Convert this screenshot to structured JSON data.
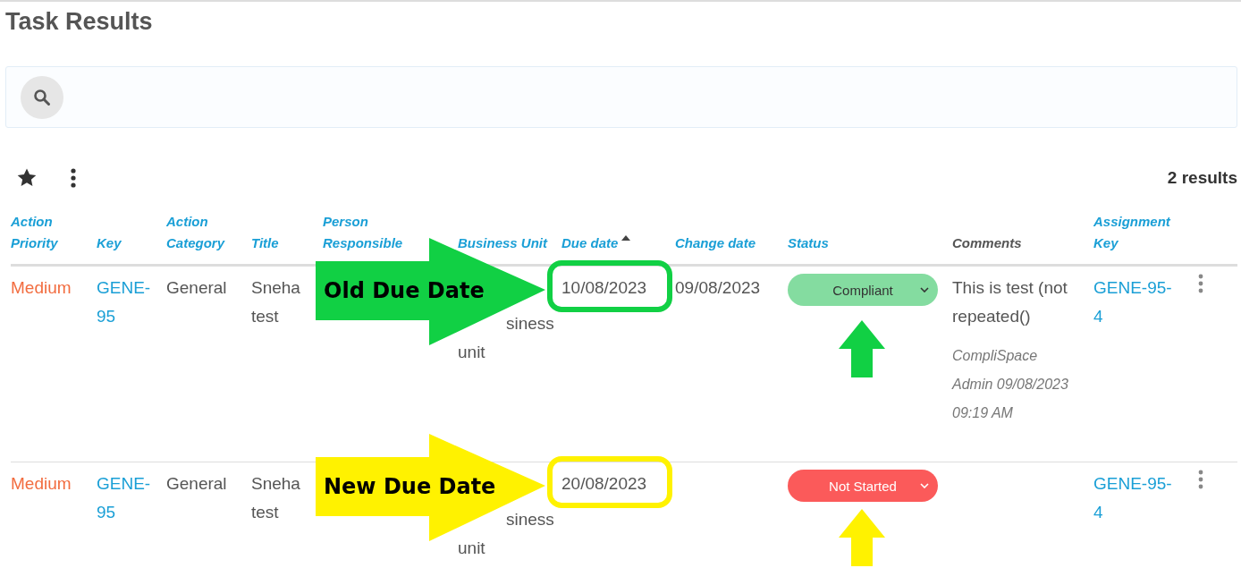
{
  "page": {
    "title": "Task Results"
  },
  "toolbar": {
    "results": "2 results"
  },
  "table": {
    "columns": [
      {
        "label": "Action Priority",
        "link": true,
        "sorted": false
      },
      {
        "label": "Key",
        "link": true,
        "sorted": false
      },
      {
        "label": "Action Category",
        "link": true,
        "sorted": false
      },
      {
        "label": "Title",
        "link": true,
        "sorted": false
      },
      {
        "label": "Person Responsible",
        "link": true,
        "sorted": false
      },
      {
        "label": "Business Unit",
        "link": true,
        "sorted": false
      },
      {
        "label": "Due date",
        "link": true,
        "sorted": true
      },
      {
        "label": "Change date",
        "link": true,
        "sorted": false
      },
      {
        "label": "Status",
        "link": true,
        "sorted": false
      },
      {
        "label": "Comments",
        "link": false,
        "sorted": false
      },
      {
        "label": "Assignment Key",
        "link": true,
        "sorted": false
      }
    ],
    "rows": [
      {
        "priority": "Medium",
        "key": "GENE-95",
        "category": "General",
        "title": "Sneha test",
        "business_unit": "siness unit",
        "due_date": "10/08/2023",
        "change_date": "09/08/2023",
        "status": {
          "label": "Compliant",
          "kind": "compliant"
        },
        "comment": {
          "text": "This is test (not repeated()",
          "meta": "CompliSpace Admin 09/08/2023 09:19 AM"
        },
        "assignment_key": "GENE-95-4",
        "annotation": {
          "label": "Old Due Date",
          "color": "#11d044"
        }
      },
      {
        "priority": "Medium",
        "key": "GENE-95",
        "category": "General",
        "title": "Sneha test",
        "business_unit": "siness unit",
        "due_date": "20/08/2023",
        "status": {
          "label": "Not Started",
          "kind": "not_started"
        },
        "assignment_key": "GENE-95-4",
        "annotation": {
          "label": "New Due Date",
          "color": "#fff200"
        }
      }
    ]
  }
}
